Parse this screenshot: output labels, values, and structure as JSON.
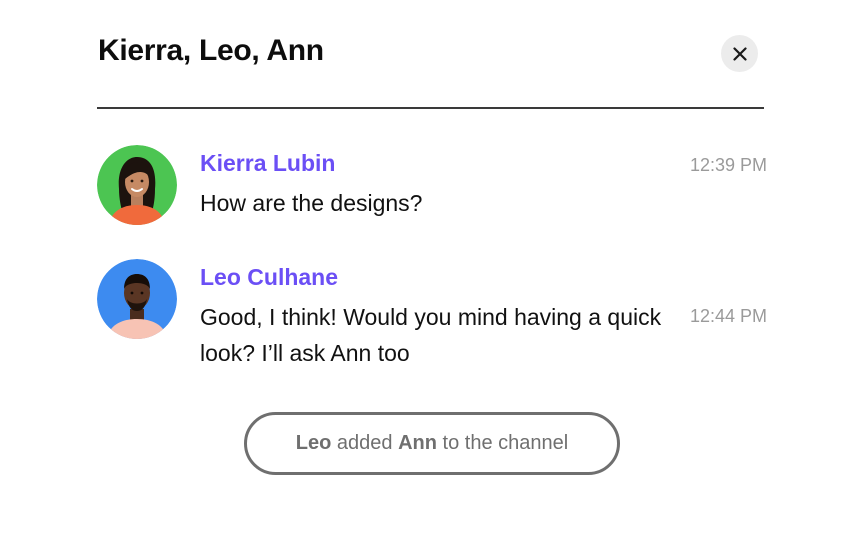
{
  "header": {
    "title": "Kierra, Leo, Ann",
    "close_icon": "close-icon"
  },
  "messages": [
    {
      "sender": "Kierra Lubin",
      "text": "How are the designs?",
      "time": "12:39 PM",
      "avatar_bg": "#4cc552"
    },
    {
      "sender": "Leo Culhane",
      "text": "Good, I think! Would you mind having a quick look? I’ll ask Ann too",
      "time": "12:44 PM",
      "avatar_bg": "#3d8bf0"
    }
  ],
  "system_event": {
    "actor": "Leo",
    "verb": " added ",
    "target": "Ann",
    "suffix": " to the channel"
  },
  "colors": {
    "sender_name": "#6b4ff5",
    "timestamp": "#9a9a9a",
    "pill_border": "#6f6f6f"
  }
}
